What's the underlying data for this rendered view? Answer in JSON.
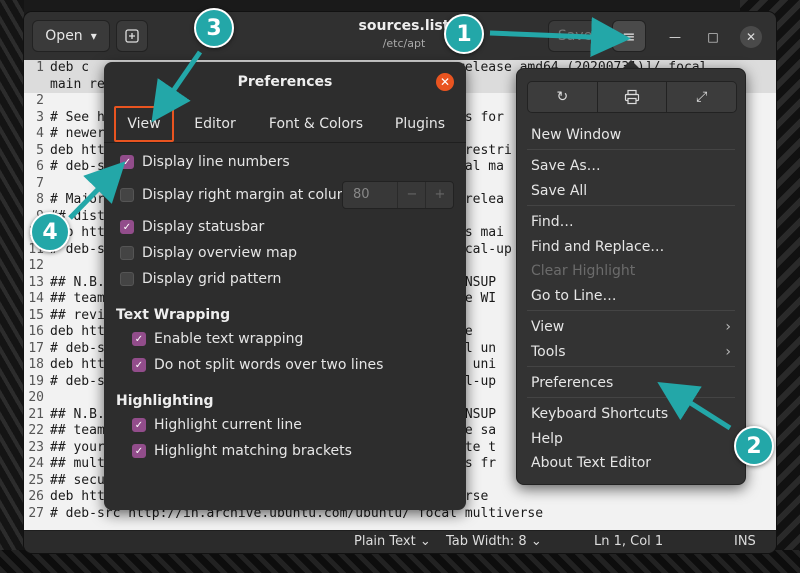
{
  "header": {
    "open_label": "Open",
    "open_chevron": "▾",
    "title": "sources.list",
    "subtitle": "/etc/apt",
    "save_label": "Save",
    "menu_icon": "≡"
  },
  "editor": {
    "lines": [
      {
        "n": "1",
        "text": "deb c                                               release amd64 (20200731)]/ focal"
      },
      {
        "n": "",
        "text": "main re"
      },
      {
        "n": "2",
        "text": ""
      },
      {
        "n": "3",
        "text": "# See h                                             es for"
      },
      {
        "n": "4",
        "text": "# newer"
      },
      {
        "n": "5",
        "text": "deb htt                                              restri"
      },
      {
        "n": "6",
        "text": "# deb-s                                             cal ma"
      },
      {
        "n": "7",
        "text": ""
      },
      {
        "n": "8",
        "text": "# Major                                              relea"
      },
      {
        "n": "9",
        "text": "## dist"
      },
      {
        "n": "10",
        "text": "deb htt                                             es mai"
      },
      {
        "n": "11",
        "text": "# deb-s                                            focal-up"
      },
      {
        "n": "12",
        "text": ""
      },
      {
        "n": "13",
        "text": "## N.B.                                             UNSUP"
      },
      {
        "n": "14",
        "text": "## team                                            rse WI"
      },
      {
        "n": "15",
        "text": "## revi                                            m."
      },
      {
        "n": "16",
        "text": "deb htt                                            rse"
      },
      {
        "n": "17",
        "text": "# deb-s                                            cal un"
      },
      {
        "n": "18",
        "text": "deb htt                                            es uni"
      },
      {
        "n": "19",
        "text": "# deb-s                                            cal-up"
      },
      {
        "n": "20",
        "text": ""
      },
      {
        "n": "21",
        "text": "## N.B.                                             UNSUP"
      },
      {
        "n": "22",
        "text": "## team                                            ase sa"
      },
      {
        "n": "23",
        "text": "## your                                            note t"
      },
      {
        "n": "24",
        "text": "## mult                                            tes fr"
      },
      {
        "n": "25",
        "text": "## secu"
      },
      {
        "n": "26",
        "text": "deb htt                                            verse"
      },
      {
        "n": "27",
        "text": "# deb-src http://in.archive.ubuntu.com/ubuntu/ focal multiverse"
      }
    ]
  },
  "statusbar": {
    "language": "Plain Text",
    "tab_width": "Tab Width: 8",
    "position": "Ln 1, Col 1",
    "mode": "INS"
  },
  "preferences": {
    "title": "Preferences",
    "tabs": [
      "View",
      "Editor",
      "Font & Colors",
      "Plugins"
    ],
    "active_tab": "View",
    "options": [
      {
        "label": "Display line numbers",
        "checked": true
      },
      {
        "label": "Display right margin at column:",
        "checked": false
      },
      {
        "label": "Display statusbar",
        "checked": true
      },
      {
        "label": "Display overview map",
        "checked": false
      },
      {
        "label": "Display grid pattern",
        "checked": false
      }
    ],
    "margin_value": "80",
    "text_wrapping": {
      "heading": "Text Wrapping",
      "options": [
        {
          "label": "Enable text wrapping",
          "checked": true
        },
        {
          "label": "Do not split words over two lines",
          "checked": true
        }
      ]
    },
    "highlighting": {
      "heading": "Highlighting",
      "options": [
        {
          "label": "Highlight current line",
          "checked": true
        },
        {
          "label": "Highlight matching brackets",
          "checked": true
        }
      ]
    }
  },
  "menu": {
    "icon_buttons": [
      "refresh-icon",
      "print-icon",
      "fullscreen-icon"
    ],
    "items": [
      {
        "label": "New Window"
      },
      {
        "label": "Save As…"
      },
      {
        "label": "Save All"
      },
      {
        "label": "Find…"
      },
      {
        "label": "Find and Replace…"
      },
      {
        "label": "Clear Highlight",
        "disabled": true
      },
      {
        "label": "Go to Line…"
      },
      {
        "label": "View",
        "submenu": true
      },
      {
        "label": "Tools",
        "submenu": true
      },
      {
        "label": "Preferences"
      },
      {
        "label": "Keyboard Shortcuts"
      },
      {
        "label": "Help"
      },
      {
        "label": "About Text Editor"
      }
    ]
  },
  "annotations": {
    "badges": [
      "1",
      "2",
      "3",
      "4"
    ],
    "accent_color": "#23a7a8"
  },
  "colors": {
    "accent_orange": "#e95420",
    "checkbox_purple": "#924d8b"
  }
}
